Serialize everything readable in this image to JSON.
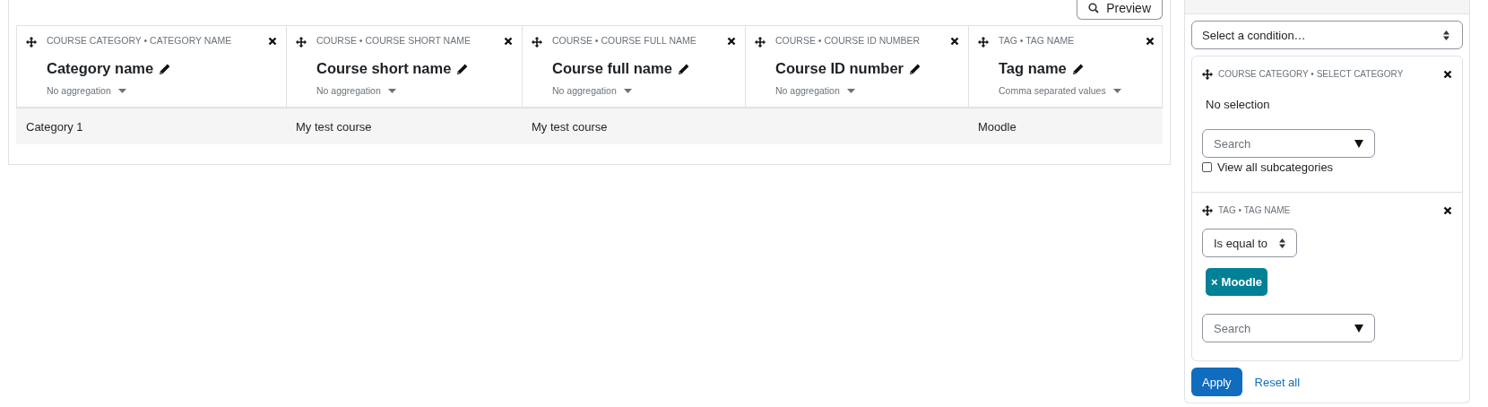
{
  "preview_button": {
    "label": "Preview"
  },
  "table": {
    "columns": [
      {
        "source": "COURSE CATEGORY • CATEGORY NAME",
        "title": "Category name",
        "aggregation": "No aggregation"
      },
      {
        "source": "COURSE • COURSE SHORT NAME",
        "title": "Course short name",
        "aggregation": "No aggregation"
      },
      {
        "source": "COURSE • COURSE FULL NAME",
        "title": "Course full name",
        "aggregation": "No aggregation"
      },
      {
        "source": "COURSE • COURSE ID NUMBER",
        "title": "Course ID number",
        "aggregation": "No aggregation"
      },
      {
        "source": "TAG • TAG NAME",
        "title": "Tag name",
        "aggregation": "Comma separated values"
      }
    ],
    "rows": [
      [
        "Category 1",
        "My test course",
        "My test course",
        "",
        "Moodle"
      ]
    ]
  },
  "conditions": {
    "select": "Select a condition…",
    "items": [
      {
        "kind": "category",
        "source": "COURSE CATEGORY • SELECT CATEGORY",
        "selection": "No selection",
        "search_placeholder": "Search",
        "checkbox": {
          "label": "View all subcategories",
          "checked": false
        }
      },
      {
        "kind": "tag",
        "source": "TAG • TAG NAME",
        "operator": "Is equal to",
        "chips": [
          "Moodle"
        ],
        "chip_remove": "×",
        "search_placeholder": "Search"
      }
    ],
    "apply": "Apply",
    "reset": "Reset all"
  }
}
